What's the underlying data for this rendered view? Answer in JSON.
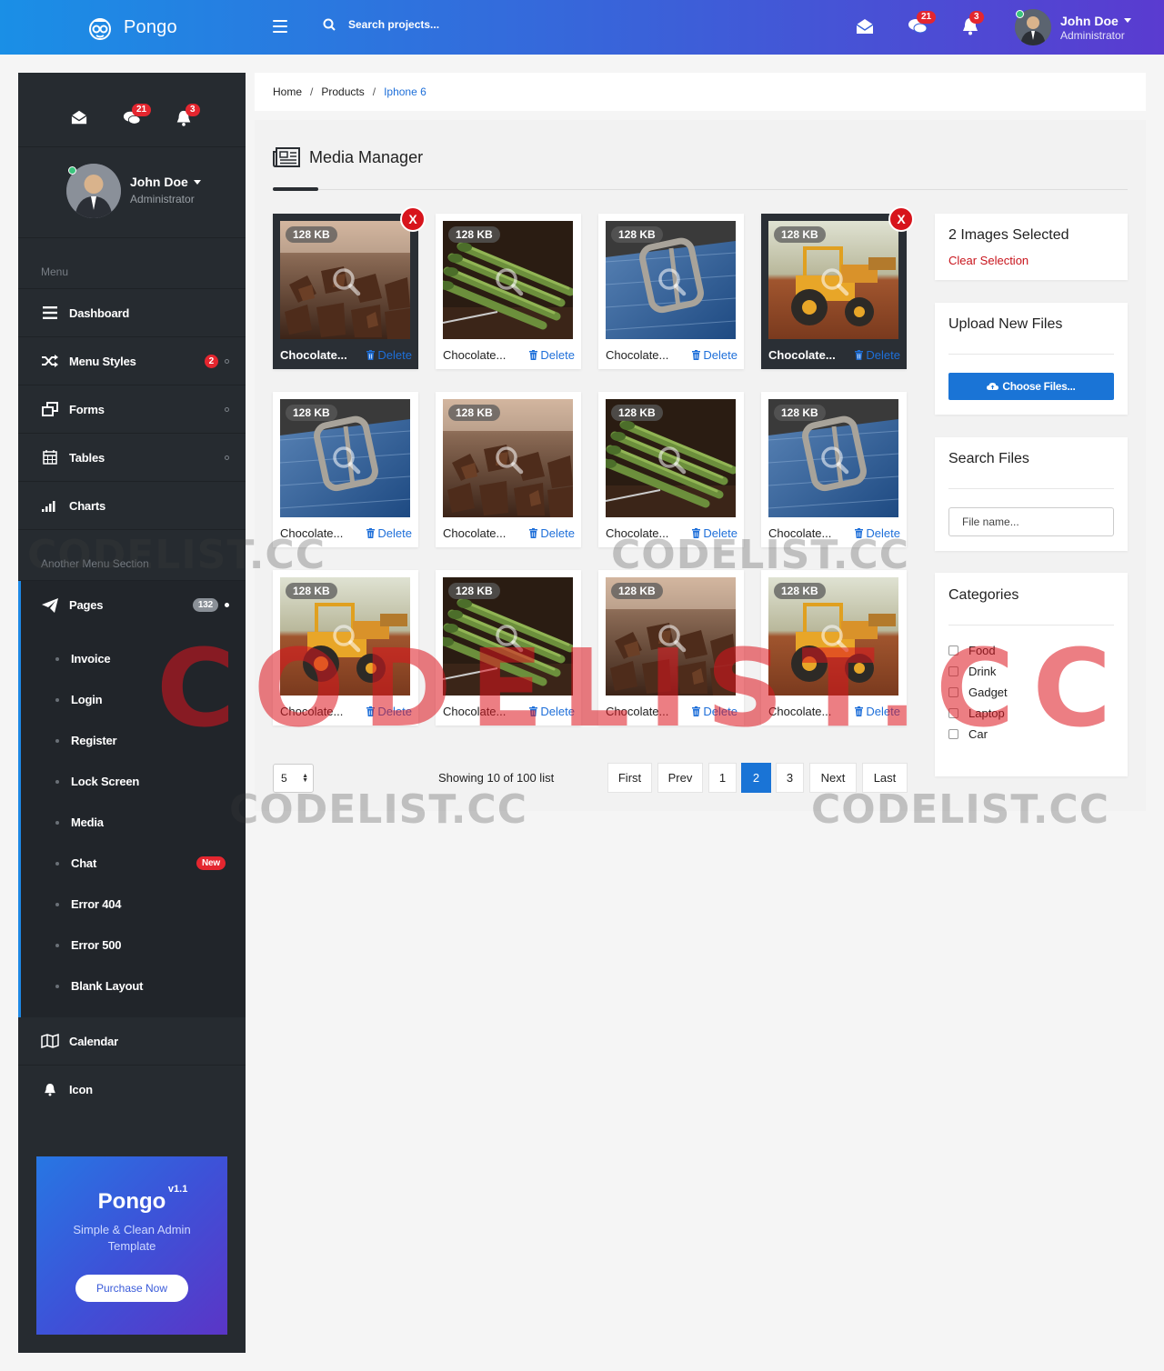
{
  "brand": {
    "name": "Pongo"
  },
  "search": {
    "placeholder": "Search projects..."
  },
  "header": {
    "messages_badge": "21",
    "notifications_badge": "3",
    "user_name": "John Doe",
    "user_role": "Administrator"
  },
  "sidebar": {
    "messages_badge": "21",
    "notifications_badge": "3",
    "user_name": "John Doe",
    "user_role": "Administrator",
    "section1": "Menu",
    "items": [
      {
        "label": "Dashboard",
        "icon": "list-icon"
      },
      {
        "label": "Menu Styles",
        "icon": "shuffle-icon",
        "badge": "2"
      },
      {
        "label": "Forms",
        "icon": "clone-icon"
      },
      {
        "label": "Tables",
        "icon": "calendar-grid-icon"
      },
      {
        "label": "Charts",
        "icon": "signal-bars-icon"
      }
    ],
    "section2": "Another Menu Section",
    "pages": {
      "label": "Pages",
      "badge": "132",
      "sub": [
        "Invoice",
        "Login",
        "Register",
        "Lock Screen",
        "Media",
        "Chat",
        "Error 404",
        "Error 500",
        "Blank Layout"
      ],
      "chat_badge": "New"
    },
    "bottom_items": [
      {
        "label": "Calendar",
        "icon": "map-icon"
      },
      {
        "label": "Icon",
        "icon": "bell-icon"
      }
    ],
    "promo": {
      "title": "Pongo",
      "version": "v1.1",
      "desc": "Simple & Clean Admin Template",
      "button": "Purchase Now"
    }
  },
  "breadcrumb": {
    "home": "Home",
    "products": "Products",
    "current": "Iphone 6"
  },
  "media": {
    "title": "Media Manager",
    "delete_label": "Delete",
    "tiles": [
      {
        "name": "Chocolate...",
        "size": "128 KB",
        "image": "chocolate",
        "selected": true
      },
      {
        "name": "Chocolate...",
        "size": "128 KB",
        "image": "asparagus",
        "selected": false
      },
      {
        "name": "Chocolate...",
        "size": "128 KB",
        "image": "jeans",
        "selected": false
      },
      {
        "name": "Chocolate...",
        "size": "128 KB",
        "image": "tractor",
        "selected": true
      },
      {
        "name": "Chocolate...",
        "size": "128 KB",
        "image": "jeans",
        "selected": false
      },
      {
        "name": "Chocolate...",
        "size": "128 KB",
        "image": "chocolate",
        "selected": false
      },
      {
        "name": "Chocolate...",
        "size": "128 KB",
        "image": "asparagus",
        "selected": false
      },
      {
        "name": "Chocolate...",
        "size": "128 KB",
        "image": "jeans",
        "selected": false
      },
      {
        "name": "Chocolate...",
        "size": "128 KB",
        "image": "tractor",
        "selected": false
      },
      {
        "name": "Chocolate...",
        "size": "128 KB",
        "image": "asparagus",
        "selected": false
      },
      {
        "name": "Chocolate...",
        "size": "128 KB",
        "image": "chocolate",
        "selected": false
      },
      {
        "name": "Chocolate...",
        "size": "128 KB",
        "image": "tractor",
        "selected": false
      }
    ]
  },
  "pagination": {
    "page_size": "5",
    "showing": "Showing 10 of 100 list",
    "buttons": [
      "First",
      "Prev",
      "1",
      "2",
      "3",
      "Next",
      "Last"
    ],
    "active": "2"
  },
  "widgets": {
    "selection_title": "2 Images Selected",
    "clear_selection": "Clear Selection",
    "upload_title": "Upload New Files",
    "choose_files": "Choose Files...",
    "search_title": "Search Files",
    "search_placeholder": "File name...",
    "categories_title": "Categories",
    "categories": [
      "Food",
      "Drink",
      "Gadget",
      "Laptop",
      "Car"
    ]
  },
  "watermark": "CODELIST.CC",
  "colors": {
    "accent": "#1a74d6",
    "danger": "#d7141c",
    "sidebar": "#262b30"
  }
}
